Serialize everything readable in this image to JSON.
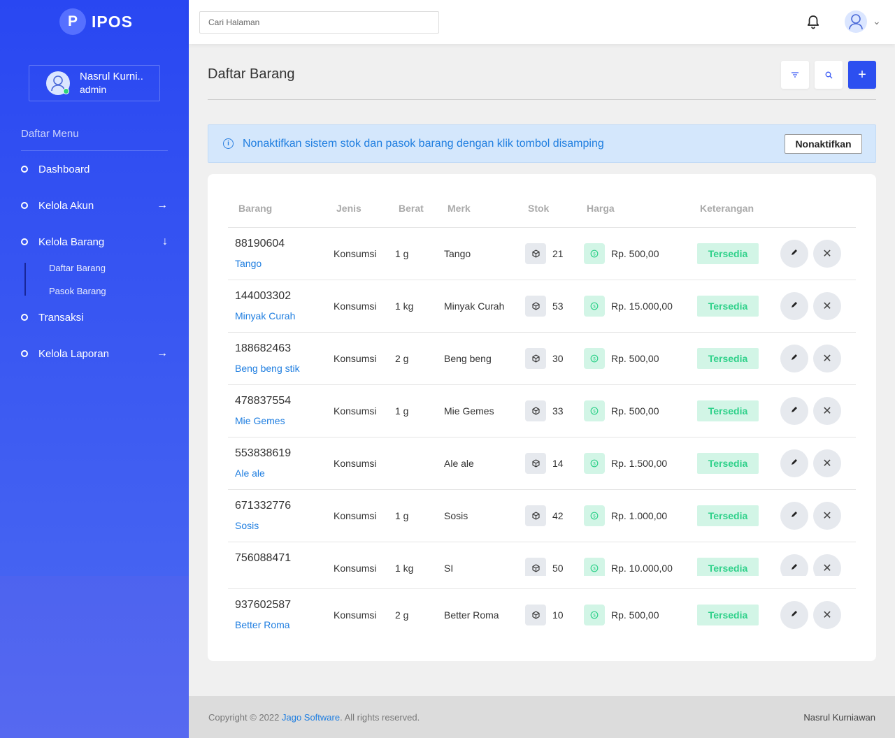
{
  "app": {
    "logo_letter": "P",
    "logo_text": "IPOS"
  },
  "user": {
    "name": "Nasrul Kurni..",
    "role": "admin"
  },
  "sidebar": {
    "menu_title": "Daftar Menu",
    "items": [
      {
        "label": "Dashboard",
        "arrow": ""
      },
      {
        "label": "Kelola Akun",
        "arrow": "→"
      },
      {
        "label": "Kelola Barang",
        "arrow": "↓"
      },
      {
        "label": "Transaksi",
        "arrow": ""
      },
      {
        "label": "Kelola Laporan",
        "arrow": "→"
      }
    ],
    "submenu": [
      {
        "label": "Daftar Barang"
      },
      {
        "label": "Pasok Barang"
      }
    ]
  },
  "topbar": {
    "search_placeholder": "Cari Halaman"
  },
  "page": {
    "title": "Daftar Barang",
    "add_label": "+"
  },
  "alert": {
    "text": "Nonaktifkan sistem stok dan pasok barang dengan klik tombol disamping",
    "button": "Nonaktifkan"
  },
  "table": {
    "headers": [
      "Barang",
      "Jenis",
      "Berat",
      "Merk",
      "Stok",
      "Harga",
      "Keterangan"
    ],
    "rows": [
      {
        "code": "88190604",
        "name": "Tango",
        "jenis": "Konsumsi",
        "berat": "1 g",
        "merk": "Tango",
        "stok": "21",
        "harga": "Rp. 500,00",
        "status": "Tersedia"
      },
      {
        "code": "144003302",
        "name": "Minyak Curah",
        "jenis": "Konsumsi",
        "berat": "1 kg",
        "merk": "Minyak Curah",
        "stok": "53",
        "harga": "Rp. 15.000,00",
        "status": "Tersedia"
      },
      {
        "code": "188682463",
        "name": "Beng beng stik",
        "jenis": "Konsumsi",
        "berat": "2 g",
        "merk": "Beng beng",
        "stok": "30",
        "harga": "Rp. 500,00",
        "status": "Tersedia"
      },
      {
        "code": "478837554",
        "name": "Mie Gemes",
        "jenis": "Konsumsi",
        "berat": "1 g",
        "merk": "Mie Gemes",
        "stok": "33",
        "harga": "Rp. 500,00",
        "status": "Tersedia"
      },
      {
        "code": "553838619",
        "name": "Ale ale",
        "jenis": "Konsumsi",
        "berat": "",
        "merk": "Ale ale",
        "stok": "14",
        "harga": "Rp. 1.500,00",
        "status": "Tersedia"
      },
      {
        "code": "671332776",
        "name": "Sosis",
        "jenis": "Konsumsi",
        "berat": "1 g",
        "merk": "Sosis",
        "stok": "42",
        "harga": "Rp. 1.000,00",
        "status": "Tersedia"
      },
      {
        "code": "756088471",
        "name": "",
        "jenis": "Konsumsi",
        "berat": "1 kg",
        "merk": "SI",
        "stok": "50",
        "harga": "Rp. 10.000,00",
        "status": "Tersedia"
      },
      {
        "code": "937602587",
        "name": "Better Roma",
        "jenis": "Konsumsi",
        "berat": "2 g",
        "merk": "Better Roma",
        "stok": "10",
        "harga": "Rp. 500,00",
        "status": "Tersedia"
      }
    ]
  },
  "footer": {
    "prefix": "Copyright © 2022 ",
    "link": "Jago Software",
    "suffix": ". All rights reserved.",
    "right": "Nasrul Kurniawan"
  },
  "colors": {
    "primary": "#2c4ff0",
    "status_bg": "#d2f5e6",
    "status_text": "#2fd18a",
    "alert_text": "#1f7ee0"
  }
}
